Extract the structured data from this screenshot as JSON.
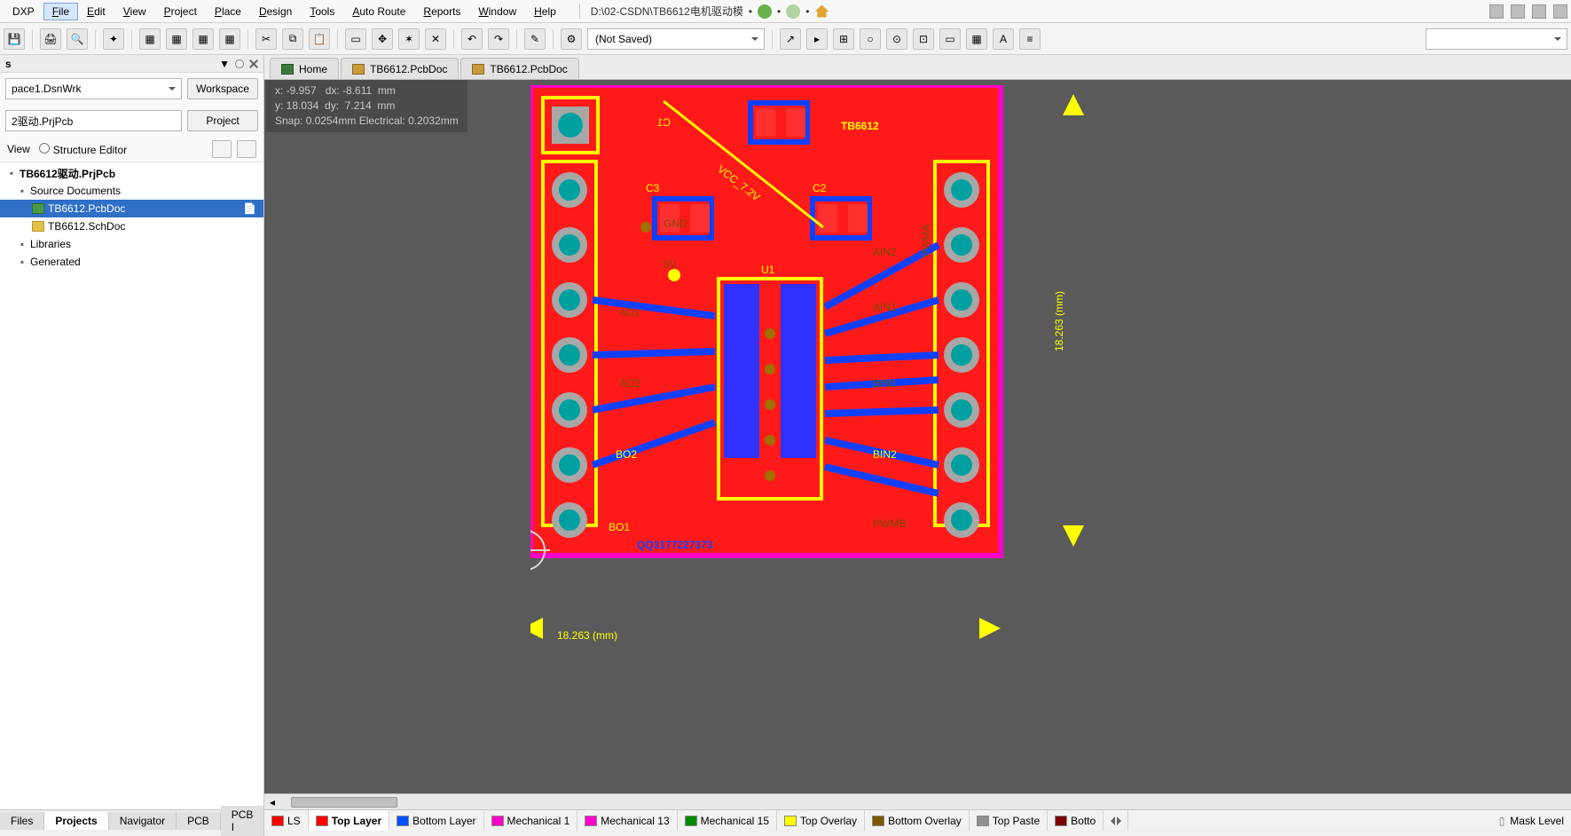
{
  "menu": {
    "items": [
      "DXP",
      "File",
      "Edit",
      "View",
      "Project",
      "Place",
      "Design",
      "Tools",
      "Auto Route",
      "Reports",
      "Window",
      "Help"
    ],
    "active_index": 1,
    "file_path": "D:\\02-CSDN\\TB6612电机驱动模"
  },
  "toolbar": {
    "doc_state": "(Not Saved)"
  },
  "sidebar": {
    "title": "s",
    "workspace_value": "pace1.DsnWrk",
    "workspace_btn": "Workspace",
    "project_value": "2驱动.PrjPcb",
    "project_btn": "Project",
    "view_label": "View",
    "structure_label": "Structure Editor",
    "tree": {
      "root": "TB6612驱动.PrjPcb",
      "group": "Source Documents",
      "doc1": "TB6612.PcbDoc",
      "doc2": "TB6612.SchDoc",
      "node_lib": "Libraries",
      "node_gen": "Generated"
    },
    "bottom_tabs": [
      "Files",
      "Projects",
      "Navigator",
      "PCB",
      "PCB I"
    ],
    "bottom_active": 1
  },
  "doc_tabs": {
    "items": [
      "Home",
      "TB6612.PcbDoc",
      "TB6612.PcbDoc"
    ]
  },
  "coord": {
    "line1": "x: -9.957   dx: -8.611  mm",
    "line2": "y: 18.034  dy:  7.214  mm",
    "line3": "Snap: 0.0254mm Electrical: 0.2032mm"
  },
  "pcb": {
    "board_label": "TB6612",
    "net_label_main": "VCC_7.2V",
    "c1": "C1",
    "c2": "C2",
    "c3": "C3",
    "u1": "U1",
    "ao1": "AO1",
    "ao2": "AO2",
    "bo2": "BO2",
    "bo1": "BO1",
    "gnd": "GND",
    "v5": "5V",
    "pwma": "PWMA",
    "ain2": "AIN2",
    "ain1": "AIN1",
    "bin1": "BIN1",
    "bin2": "BIN2",
    "pwmb": "PWMB",
    "qq": "QQ3177227373",
    "dim_x": "18.263 (mm)",
    "dim_y": "18.263 (mm)"
  },
  "layer_tabs": {
    "ls": "LS",
    "items": [
      {
        "name": "Top Layer",
        "color": "#ff0000",
        "active": true
      },
      {
        "name": "Bottom Layer",
        "color": "#0050ff"
      },
      {
        "name": "Mechanical 1",
        "color": "#ff00c8"
      },
      {
        "name": "Mechanical 13",
        "color": "#ff00c8"
      },
      {
        "name": "Mechanical 15",
        "color": "#008a00"
      },
      {
        "name": "Top Overlay",
        "color": "#ffff00"
      },
      {
        "name": "Bottom Overlay",
        "color": "#7a5a00"
      },
      {
        "name": "Top Paste",
        "color": "#909090"
      },
      {
        "name": "Botto",
        "color": "#7a0000"
      }
    ],
    "mask": "Mask Level"
  }
}
